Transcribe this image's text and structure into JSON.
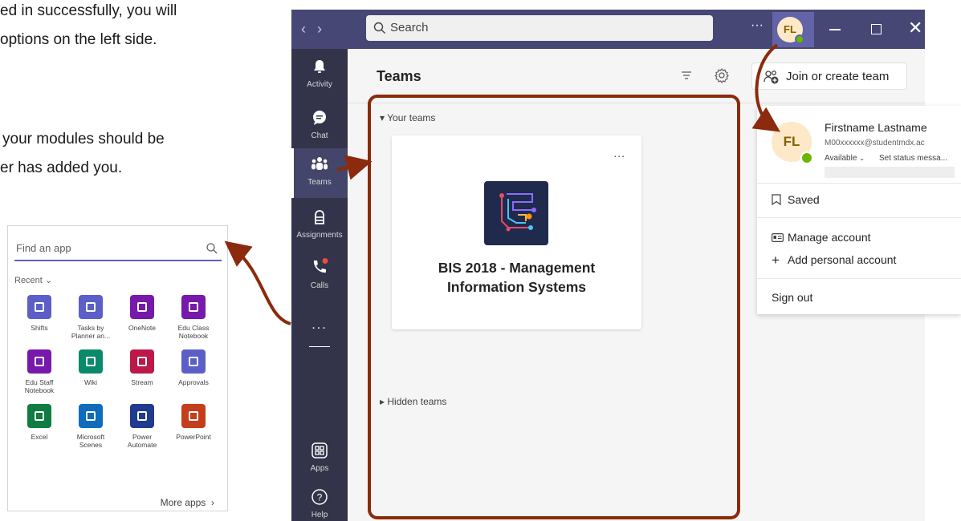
{
  "document": {
    "lines": [
      "ed in successfully,  you will",
      "options on the left side.",
      "your modules should be",
      "er has added you."
    ]
  },
  "app_picker": {
    "search_placeholder": "Find an app",
    "recent_label": "Recent",
    "apps": [
      {
        "label": "Shifts",
        "color": "#5b5fc7",
        "icon": "shifts-icon"
      },
      {
        "label": "Tasks by Planner an...",
        "color": "#5b5fc7",
        "icon": "tasks-icon"
      },
      {
        "label": "OneNote",
        "color": "#7719aa",
        "icon": "onenote-icon"
      },
      {
        "label": "Edu Class Notebook",
        "color": "#7719aa",
        "icon": "class-notebook-icon"
      },
      {
        "label": "Edu Staff Notebook",
        "color": "#7719aa",
        "icon": "staff-notebook-icon"
      },
      {
        "label": "Wiki",
        "color": "#0b8a6b",
        "icon": "wiki-icon"
      },
      {
        "label": "Stream",
        "color": "#bc1948",
        "icon": "stream-icon"
      },
      {
        "label": "Approvals",
        "color": "#5b5fc7",
        "icon": "approvals-icon"
      },
      {
        "label": "Excel",
        "color": "#107c41",
        "icon": "excel-icon"
      },
      {
        "label": "Microsoft Scenes",
        "color": "#0f6cbd",
        "icon": "scenes-icon"
      },
      {
        "label": "Power Automate",
        "color": "#1f3b8f",
        "icon": "power-automate-icon"
      },
      {
        "label": "PowerPoint",
        "color": "#c43e1c",
        "icon": "powerpoint-icon"
      }
    ],
    "more_apps": "More apps"
  },
  "titlebar": {
    "search_placeholder": "Search",
    "avatar_initials": "FL"
  },
  "rail": {
    "items": [
      {
        "label": "Activity",
        "icon": "bell-icon"
      },
      {
        "label": "Chat",
        "icon": "chat-icon"
      },
      {
        "label": "Teams",
        "icon": "teams-icon",
        "active": true
      },
      {
        "label": "Assignments",
        "icon": "assignments-icon"
      },
      {
        "label": "Calls",
        "icon": "phone-icon"
      },
      {
        "label": "Apps",
        "icon": "apps-icon"
      },
      {
        "label": "Help",
        "icon": "help-icon"
      }
    ],
    "more": "..."
  },
  "main": {
    "title": "Teams",
    "join_button": "Join or create team",
    "your_teams": "Your teams",
    "team": {
      "name_line1": "BIS 2018 - Management",
      "name_line2": "Information Systems",
      "more": "..."
    },
    "hidden_teams": "Hidden teams"
  },
  "profile": {
    "initials": "FL",
    "name": "Firstname Lastname",
    "email": "M00xxxxxx@studentmdx.ac",
    "availability": "Available",
    "set_status": "Set status messa...",
    "saved": "Saved",
    "manage_account": "Manage account",
    "add_personal": "Add personal account",
    "sign_out": "Sign out"
  },
  "colors": {
    "accent": "#6264a7",
    "titlebar": "#464775",
    "rail": "#33344a",
    "annotation": "#8b2a0c",
    "available": "#6bb700"
  }
}
